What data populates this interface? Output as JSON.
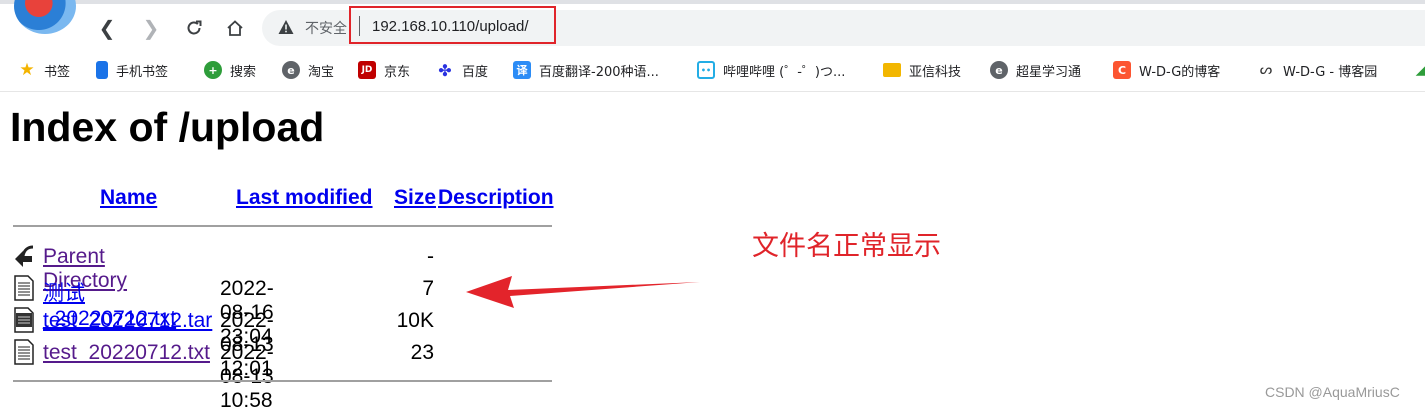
{
  "browser": {
    "insecure_label": "不安全",
    "url": "192.168.10.110/upload/",
    "bookmarks": [
      {
        "label": "书签",
        "icon": "star-icon",
        "color": "#f4b400"
      },
      {
        "label": "手机书签",
        "icon": "phone-icon",
        "color": "#1a73e8"
      },
      {
        "label": "搜索",
        "icon": "search-plus-icon",
        "color": "#2e9d3a"
      },
      {
        "label": "淘宝",
        "icon": "taobao-icon",
        "color": "#5f6368"
      },
      {
        "label": "京东",
        "icon": "jd-icon",
        "color": "#c00000"
      },
      {
        "label": "百度",
        "icon": "baidu-paw-icon",
        "color": "#2932e1"
      },
      {
        "label": "百度翻译-200种语...",
        "icon": "translate-icon",
        "color": "#2b8cf6"
      },
      {
        "label": "哔哩哔哩 (゜-゜)つ...",
        "icon": "bilibili-icon",
        "color": "#23ade5"
      },
      {
        "label": "亚信科技",
        "icon": "folder-icon",
        "color": "#f2b600"
      },
      {
        "label": "超星学习通",
        "icon": "chaoxing-icon",
        "color": "#5f6368"
      },
      {
        "label": "W-D-G的博客",
        "icon": "csdn-icon",
        "color": "#fc5531"
      },
      {
        "label": "W-D-G - 博客园",
        "icon": "cnblogs-icon",
        "color": "#333333"
      }
    ]
  },
  "page": {
    "title": "Index of /upload",
    "columns": {
      "name": "Name",
      "modified": "Last modified",
      "size": "Size",
      "description": "Description"
    },
    "rows": [
      {
        "name": "Parent Directory",
        "modified": "",
        "size": "-",
        "icon": "back-icon"
      },
      {
        "name": "测试_20220712.txt",
        "modified": "2022-08-16 23:04",
        "size": "7",
        "icon": "text-file-icon"
      },
      {
        "name": "test_20220712.tar",
        "modified": "2022-08-13 12:01",
        "size": "10K",
        "icon": "tar-file-icon"
      },
      {
        "name": "test_20220712.txt",
        "modified": "2022-08-13 10:58",
        "size": "23",
        "icon": "text-file-icon"
      }
    ]
  },
  "annotation": {
    "text": "文件名正常显示",
    "color": "#e0242a"
  },
  "watermark": "CSDN @AquaMriusC"
}
